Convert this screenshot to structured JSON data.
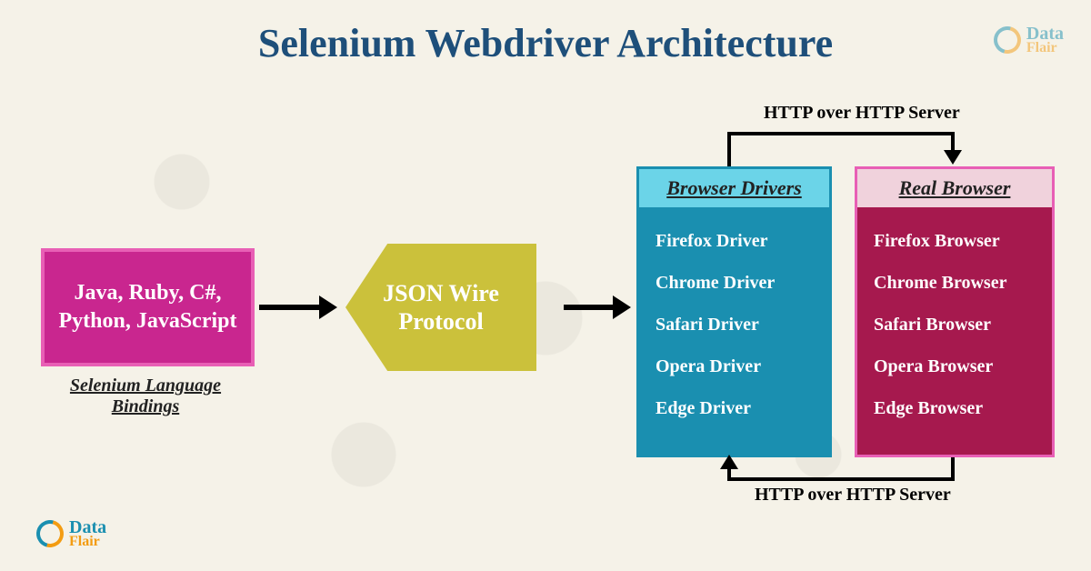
{
  "title": "Selenium Webdriver Architecture",
  "languages": {
    "text": "Java, Ruby, C#, Python, JavaScript",
    "caption": "Selenium Language Bindings"
  },
  "protocol": "JSON Wire Protocol",
  "drivers": {
    "header": "Browser Drivers",
    "items": [
      "Firefox Driver",
      "Chrome Driver",
      "Safari Driver",
      "Opera Driver",
      "Edge Driver"
    ]
  },
  "browsers": {
    "header": "Real Browser",
    "items": [
      "Firefox Browser",
      "Chrome Browser",
      "Safari Browser",
      "Opera Browser",
      "Edge Browser"
    ]
  },
  "http_label_top": "HTTP over HTTP Server",
  "http_label_bottom": "HTTP over HTTP Server",
  "brand": {
    "line1": "Data",
    "line2": "Flair"
  }
}
